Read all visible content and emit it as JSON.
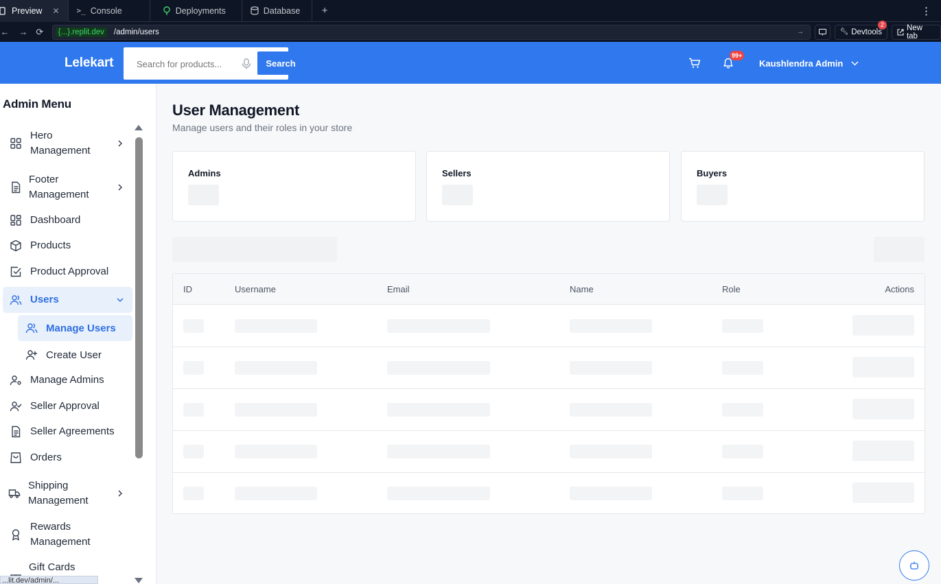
{
  "browser": {
    "tabs": [
      {
        "label": "Preview",
        "active": true
      },
      {
        "label": "Console"
      },
      {
        "label": "Deployments"
      },
      {
        "label": "Database"
      }
    ],
    "url_host": "{...}.replit.dev",
    "url_path": "/admin/users",
    "devtools_label": "Devtools",
    "devtools_badge": "2",
    "newtab_label": "New tab"
  },
  "header": {
    "logo": "Lelekart",
    "search_placeholder": "Search for products...",
    "search_button": "Search",
    "notification_badge": "99+",
    "user_name": "Kaushlendra Admin",
    "brand_color": "#2f78ed"
  },
  "sidebar": {
    "title": "Admin Menu",
    "items": [
      {
        "label": "Hero\nManagement",
        "icon": "grid-icon",
        "expandable": true
      },
      {
        "label": "Footer\nManagement",
        "icon": "document-icon",
        "expandable": true
      },
      {
        "label": "Dashboard",
        "icon": "dashboard-icon"
      },
      {
        "label": "Products",
        "icon": "package-icon"
      },
      {
        "label": "Product Approval",
        "icon": "check-square-icon"
      },
      {
        "label": "Users",
        "icon": "users-icon",
        "expanded": true,
        "active": true
      },
      {
        "label": "Manage Admins",
        "icon": "user-cog-icon"
      },
      {
        "label": "Seller Approval",
        "icon": "user-check-icon"
      },
      {
        "label": "Seller Agreements",
        "icon": "file-text-icon"
      },
      {
        "label": "Orders",
        "icon": "shopping-bag-icon"
      },
      {
        "label": "Shipping\nManagement",
        "icon": "truck-icon",
        "expandable": true
      },
      {
        "label": "Rewards\nManagement",
        "icon": "award-icon"
      },
      {
        "label": "Gift Cards",
        "icon": "gift-icon"
      }
    ],
    "subitems": [
      {
        "label": "Manage Users",
        "icon": "users-icon",
        "active": true
      },
      {
        "label": "Create User",
        "icon": "user-plus-icon"
      }
    ],
    "status_url": "...lit.dev/admin/..."
  },
  "main": {
    "title": "User Management",
    "subtitle": "Manage users and their roles in your store",
    "cards": [
      {
        "label": "Admins"
      },
      {
        "label": "Sellers"
      },
      {
        "label": "Buyers"
      }
    ],
    "table": {
      "columns": [
        "ID",
        "Username",
        "Email",
        "Name",
        "Role",
        "Actions"
      ],
      "loading_rows": 5
    }
  }
}
